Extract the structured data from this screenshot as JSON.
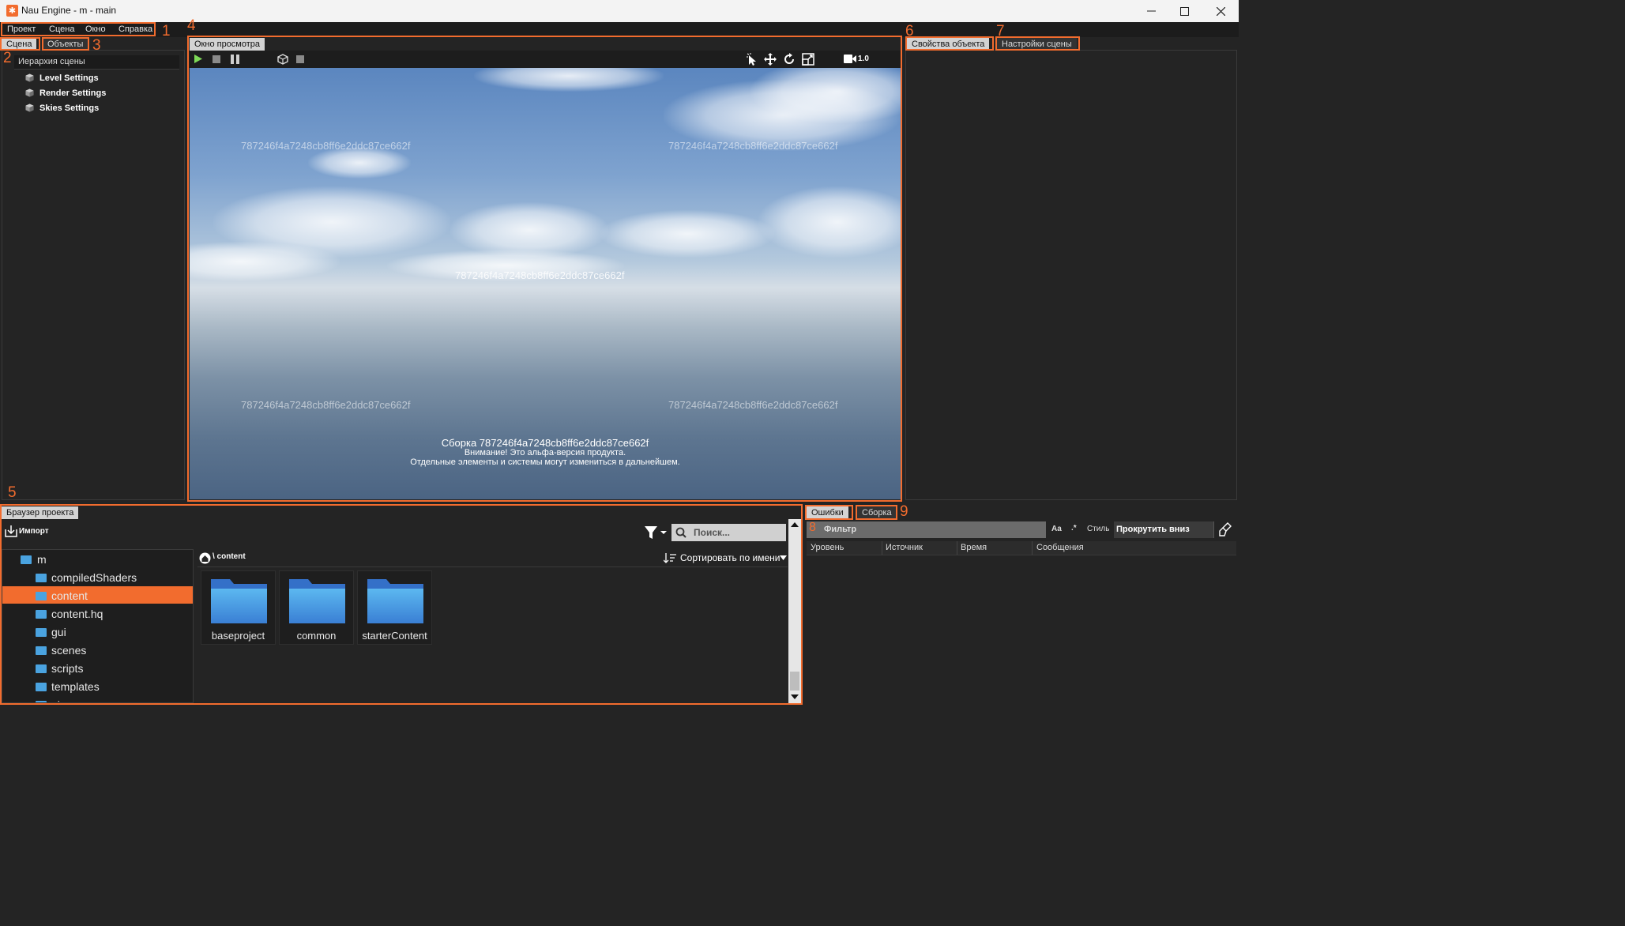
{
  "window": {
    "title": "Nau Engine - m - main",
    "app_icon": "nau-logo-icon"
  },
  "menu": {
    "items": [
      "Проект",
      "Сцена",
      "Окно",
      "Справка"
    ]
  },
  "markers": [
    "1",
    "2",
    "3",
    "4",
    "5",
    "6",
    "7",
    "8",
    "9"
  ],
  "left_panel": {
    "tabs": [
      "Сцена",
      "Объекты"
    ],
    "hierarchy_header": "Иерархия сцены",
    "items": [
      "Level Settings",
      "Render Settings",
      "Skies Settings"
    ]
  },
  "viewport": {
    "tab": "Окно просмотра",
    "camera_speed": "1.0",
    "watermark": "787246f4a7248cb8ff6e2ddc87ce662f",
    "build_line": "Сборка 787246f4a7248cb8ff6e2ddc87ce662f",
    "warning_line": "Внимание! Это альфа-версия продукта.",
    "note_line": "Отдельные элементы и системы могут измениться в дальнейшем."
  },
  "right_panel": {
    "tabs": [
      "Свойства объекта",
      "Настройки сцены"
    ]
  },
  "project_browser": {
    "tab": "Браузер проекта",
    "import_label": "Импорт",
    "search_placeholder": "Поиск...",
    "path": "\\ content",
    "sort_label": "Сортировать по имени",
    "tree_root": "m",
    "tree": [
      "compiledShaders",
      "content",
      "content.hq",
      "gui",
      "scenes",
      "scripts",
      "templates",
      "ui"
    ],
    "selected": "content",
    "folders": [
      "baseproject",
      "common",
      "starterContent"
    ]
  },
  "log_panel": {
    "tabs": [
      "Ошибки",
      "Сборка"
    ],
    "filter_placeholder": "Фильтр",
    "case_toggle": "Aa",
    "regex_toggle": ".*",
    "style_label": "Стиль",
    "scroll_label": "Прокрутить вниз",
    "columns": [
      "Уровень",
      "Источник",
      "Время",
      "Сообщения"
    ]
  },
  "colors": {
    "accent": "#f26c2e",
    "selection": "#f26c2e",
    "panel_bg": "#242424",
    "folder": "#4aa3e0"
  }
}
